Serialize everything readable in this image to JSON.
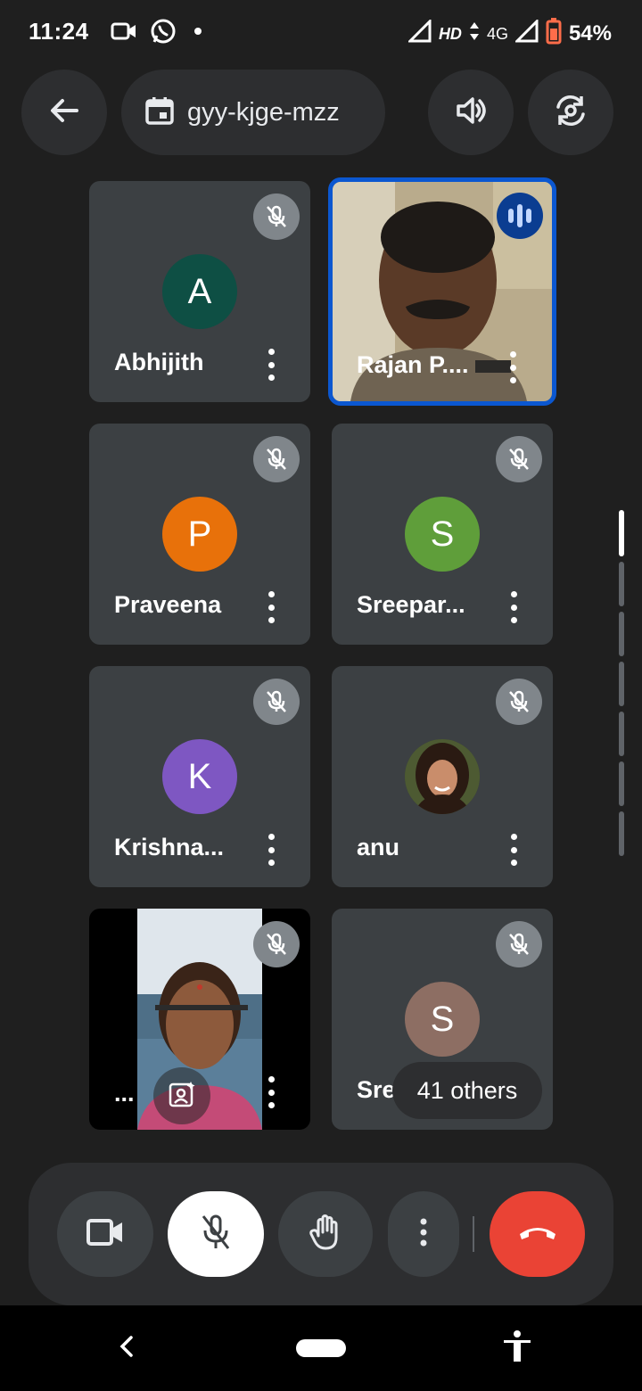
{
  "status_bar": {
    "time": "11:24",
    "hd": "HD",
    "network": "4G",
    "battery": "54%",
    "icons": [
      "video-camera-icon",
      "whatsapp-icon",
      "dot-icon",
      "signal-icon",
      "data-arrows-icon",
      "signal-icon",
      "battery-icon"
    ]
  },
  "header": {
    "back_icon": "arrow-back-icon",
    "meeting_code": "gyy-kjge-mzz",
    "calendar_icon": "calendar-icon",
    "speaker_icon": "volume-icon",
    "switch_camera_icon": "camera-switch-icon"
  },
  "participants": [
    {
      "name": "Abhijith",
      "initial": "A",
      "color": "#0e4f44",
      "muted": true,
      "type": "avatar"
    },
    {
      "name": "Rajan P....",
      "initial": "",
      "color": "#8a7b5e",
      "muted": false,
      "speaking": true,
      "type": "video"
    },
    {
      "name": "Praveena",
      "initial": "P",
      "color": "#e8710a",
      "muted": true,
      "type": "avatar"
    },
    {
      "name": "Sreepar...",
      "initial": "S",
      "color": "#5f9e3a",
      "muted": true,
      "type": "avatar"
    },
    {
      "name": "Krishna...",
      "initial": "K",
      "color": "#7e57c2",
      "muted": true,
      "type": "avatar"
    },
    {
      "name": "anu",
      "initial": "",
      "color": "#6d4c3d",
      "muted": true,
      "type": "photo"
    },
    {
      "name": "...",
      "initial": "",
      "color": "#000000",
      "muted": true,
      "type": "video"
    },
    {
      "name": "Sree",
      "initial": "S",
      "color": "#8d6e63",
      "muted": true,
      "type": "avatar"
    }
  ],
  "others_chip": "41 others",
  "controls": {
    "camera": "video-camera-icon",
    "mic": "mic-off-icon",
    "raise_hand": "raise-hand-icon",
    "more": "more-vert-icon",
    "end_call": "call-end-icon"
  },
  "colors": {
    "background": "#1f1f1f",
    "tile": "#3c4043",
    "active_border": "#0b57d0",
    "end_call": "#ea4335"
  }
}
